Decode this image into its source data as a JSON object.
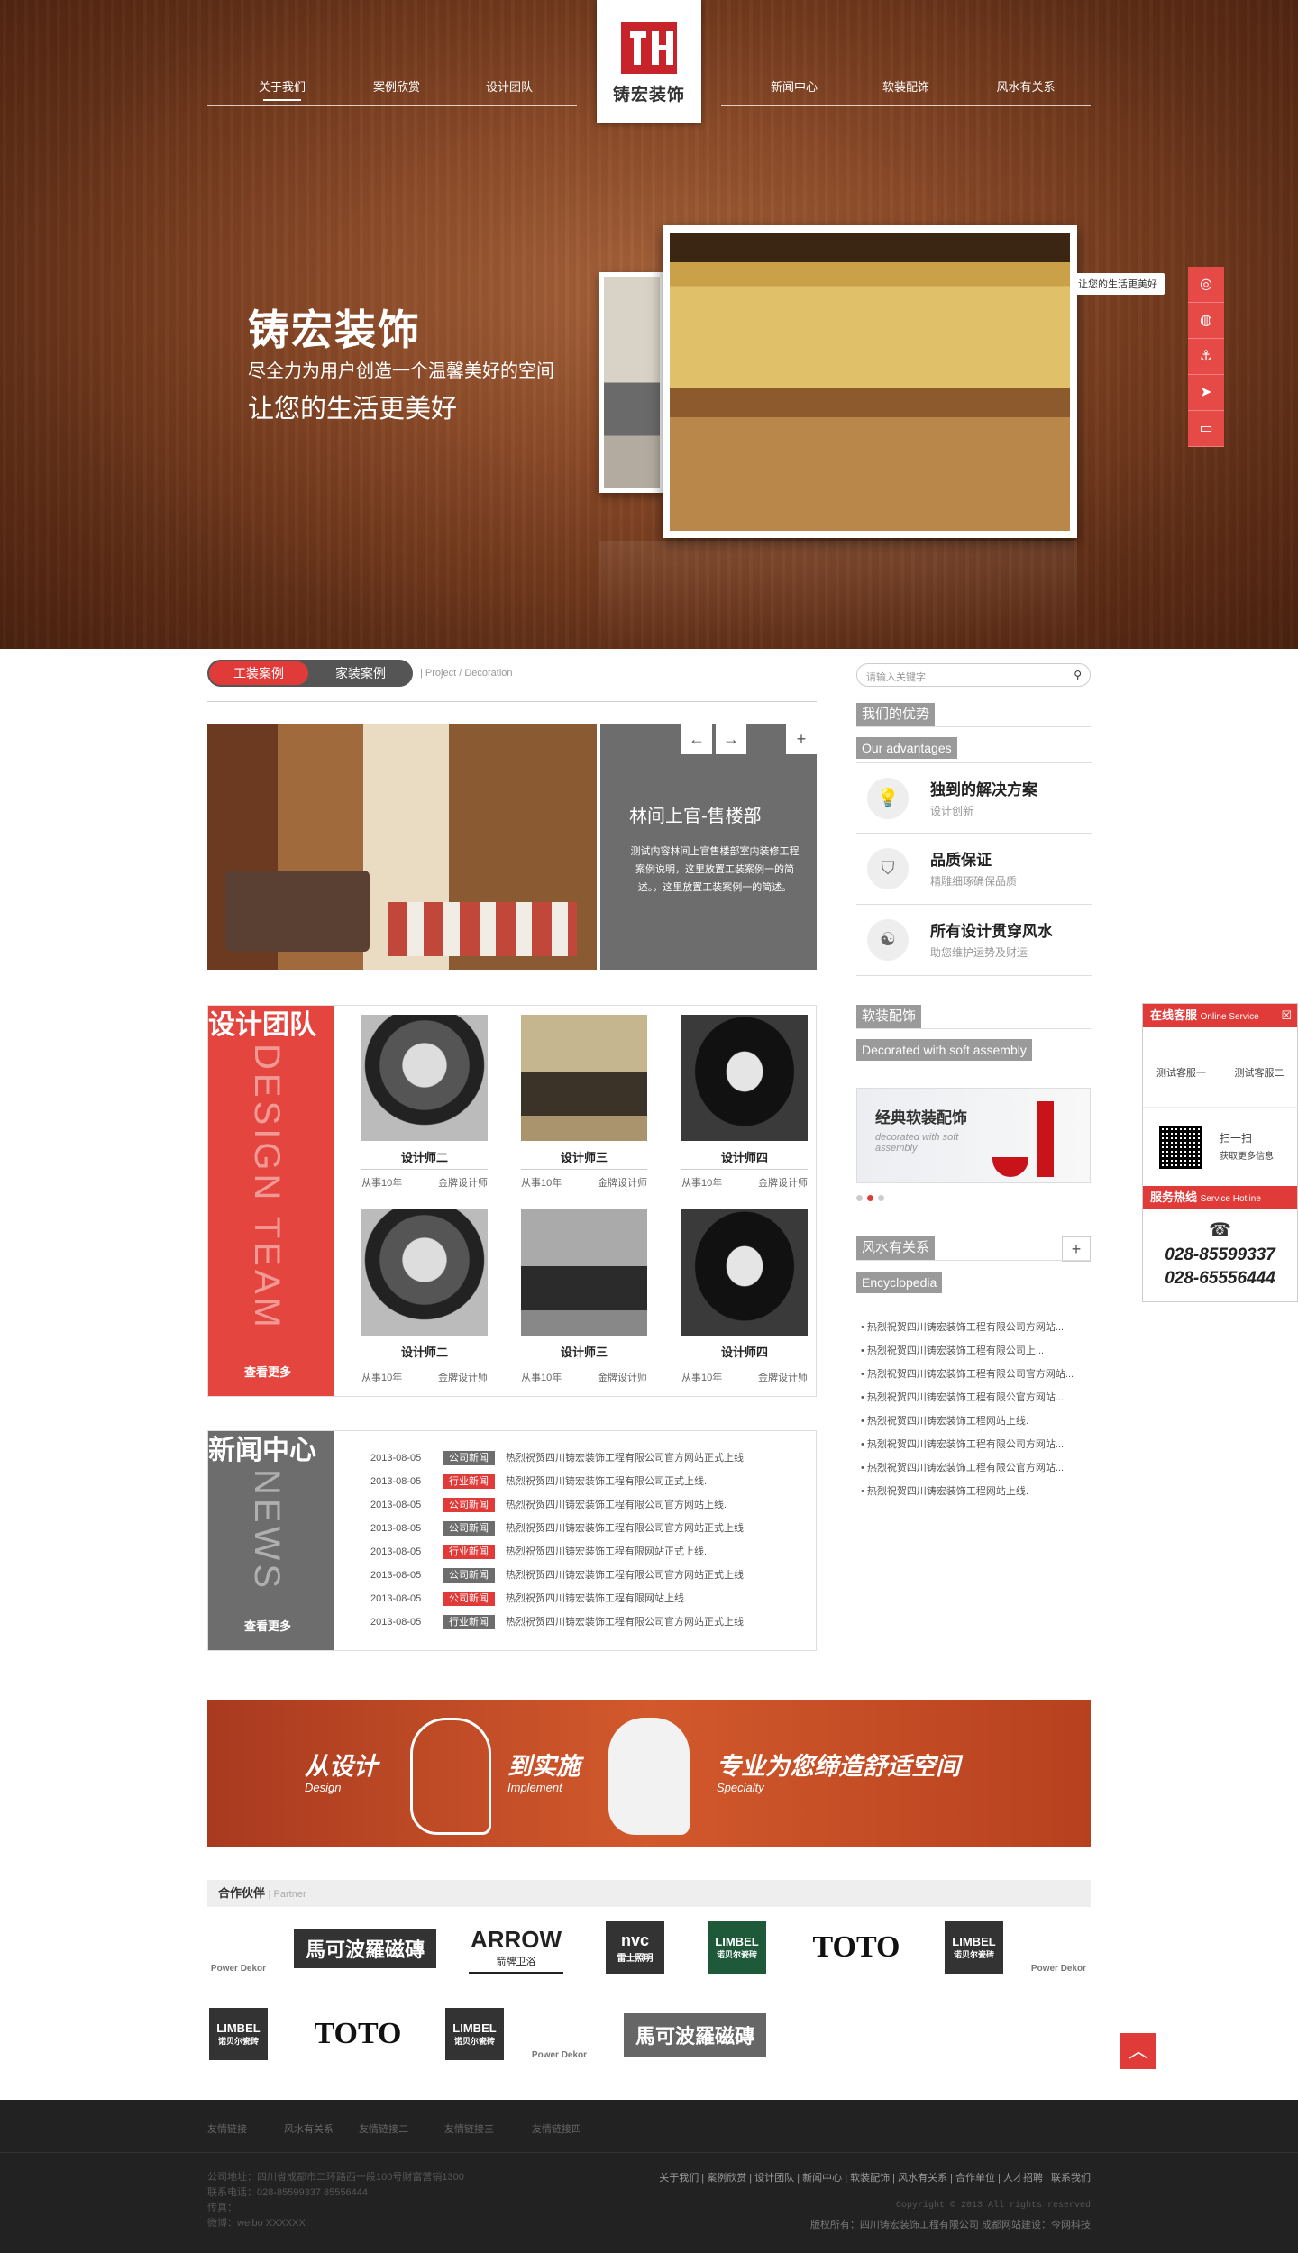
{
  "nav": {
    "left": [
      "关于我们",
      "案例欣赏",
      "设计团队"
    ],
    "right": [
      "新闻中心",
      "软装配饰",
      "风水有关系"
    ],
    "logo_text": "铸宏装饰"
  },
  "hero": {
    "title": "铸宏装饰",
    "subtitle": "尽全力为用户创造一个温馨美好的空间",
    "tagline": "让您的生活更美好",
    "tooltip": "让您的生活更美好"
  },
  "tabs": {
    "active": "工装案例",
    "other": "家装案例",
    "crumb_en": "| Project / Decoration"
  },
  "case": {
    "title": "林间上官-售楼部",
    "desc": "测试内容林间上官售楼部室内装修工程案例说明，这里放置工装案例一的简述。，这里放置工装案例一的简述。",
    "prev": "←",
    "next": "→",
    "plus": "+"
  },
  "search": {
    "placeholder": "请输入关键字"
  },
  "advantages": {
    "title_cn": "我们的优势",
    "title_en": "Our advantages",
    "items": [
      {
        "title": "独到的解决方案",
        "sub": "设计创新",
        "icon": "lightbulb-icon"
      },
      {
        "title": "品质保证",
        "sub": "精雕细琢确保品质",
        "icon": "shield-icon"
      },
      {
        "title": "所有设计贯穿风水",
        "sub": "助您维护运势及财运",
        "icon": "yinyang-icon"
      }
    ]
  },
  "decor": {
    "title_cn": "软装配饰",
    "title_en": "Decorated with soft assembly",
    "img_text": "经典软装配饰",
    "img_script": "decorated with soft assembly"
  },
  "fengshui": {
    "title_cn": "风水有关系",
    "title_en": "Encyclopedia",
    "plus": "+",
    "items": [
      "热烈祝贺四川铸宏装饰工程有限公司方网站...",
      "热烈祝贺四川铸宏装饰工程有限公司上...",
      "热烈祝贺四川铸宏装饰工程有限公司官方网站...",
      "热烈祝贺四川铸宏装饰工程有限公官方网站...",
      "热烈祝贺四川铸宏装饰工程网站上线.",
      "热烈祝贺四川铸宏装饰工程有限公司方网站...",
      "热烈祝贺四川铸宏装饰工程有限公官方网站...",
      "热烈祝贺四川铸宏装饰工程网站上线."
    ]
  },
  "team": {
    "label_cn": "设计团队",
    "label_en": "DESIGN TEAM",
    "more": "查看更多",
    "members": [
      {
        "name": "设计师二",
        "years": "从事10年",
        "rank": "金牌设计师"
      },
      {
        "name": "设计师三",
        "years": "从事10年",
        "rank": "金牌设计师"
      },
      {
        "name": "设计师四",
        "years": "从事10年",
        "rank": "金牌设计师"
      },
      {
        "name": "设计师二",
        "years": "从事10年",
        "rank": "金牌设计师"
      },
      {
        "name": "设计师三",
        "years": "从事10年",
        "rank": "金牌设计师"
      },
      {
        "name": "设计师四",
        "years": "从事10年",
        "rank": "金牌设计师"
      }
    ]
  },
  "news": {
    "label_cn": "新闻中心",
    "label_en": "NEWS",
    "more": "查看更多",
    "rows": [
      {
        "date": "2013-08-05",
        "tag": "公司新闻",
        "tone": "g",
        "title": "热烈祝贺四川铸宏装饰工程有限公司官方网站正式上线."
      },
      {
        "date": "2013-08-05",
        "tag": "行业新闻",
        "tone": "r",
        "title": "热烈祝贺四川铸宏装饰工程有限公司正式上线."
      },
      {
        "date": "2013-08-05",
        "tag": "公司新闻",
        "tone": "r",
        "title": "热烈祝贺四川铸宏装饰工程有限公司官方网站上线."
      },
      {
        "date": "2013-08-05",
        "tag": "公司新闻",
        "tone": "g",
        "title": "热烈祝贺四川铸宏装饰工程有限公司官方网站正式上线."
      },
      {
        "date": "2013-08-05",
        "tag": "行业新闻",
        "tone": "r",
        "title": "热烈祝贺四川铸宏装饰工程有限网站正式上线."
      },
      {
        "date": "2013-08-05",
        "tag": "公司新闻",
        "tone": "g",
        "title": "热烈祝贺四川铸宏装饰工程有限公司官方网站正式上线."
      },
      {
        "date": "2013-08-05",
        "tag": "公司新闻",
        "tone": "r",
        "title": "热烈祝贺四川铸宏装饰工程有限网站上线."
      },
      {
        "date": "2013-08-05",
        "tag": "行业新闻",
        "tone": "g",
        "title": "热烈祝贺四川铸宏装饰工程有限公司官方网站正式上线."
      }
    ]
  },
  "banner": {
    "w1": "从设计",
    "e1": "Design",
    "w2": "到实施",
    "e2": "Implement",
    "w3": "专业为您缔造舒适空间",
    "e3": "Specialty"
  },
  "partners": {
    "title": "合作伙伴",
    "title_en": "| Partner",
    "row1": [
      "Power Dekor",
      "馬可波羅磁磚",
      "ARROW",
      "nvc",
      "LIMBEL",
      "TOTO",
      "LIMBEL",
      "Power Dekor"
    ],
    "row1_sub": [
      "",
      "",
      "箭牌卫浴",
      "雷士照明",
      "诺贝尔瓷砖",
      "",
      "诺贝尔瓷砖",
      ""
    ],
    "row2": [
      "LIMBEL",
      "TOTO",
      "LIMBEL",
      "Power Dekor",
      "馬可波羅磁磚"
    ],
    "row2_sub": [
      "诺贝尔瓷砖",
      "",
      "诺贝尔瓷砖",
      "",
      ""
    ]
  },
  "service": {
    "title": "在线客服",
    "title_en": "Online Service",
    "agent1": "测试客服一",
    "agent2": "测试客服二",
    "scan": "扫一扫",
    "scan_sub": "获取更多信息",
    "hotline": "服务热线",
    "hotline_en": "Service Hotline",
    "tel1": "028-85599337",
    "tel2": "028-65556444"
  },
  "footer": {
    "links": [
      "友情链接",
      "风水有关系",
      "友情链接二",
      "友情链接三",
      "友情链接四"
    ],
    "address": "公司地址：四川省成都市二环路西一段100号财富营销1300",
    "phone": "联系电话：028-85599337  85556444",
    "fax": "传真：",
    "weibo": "微博：weibo XXXXXX",
    "nav": "关于我们 | 案例欣赏 | 设计团队 | 新闻中心 | 软装配饰 | 风水有关系 | 合作单位 | 人才招聘 | 联系我们",
    "copyright": "Copyright © 2013 All rights reserved",
    "owner": "版权所有：四川铸宏装饰工程有限公司    成都网站建设：今网科技"
  }
}
